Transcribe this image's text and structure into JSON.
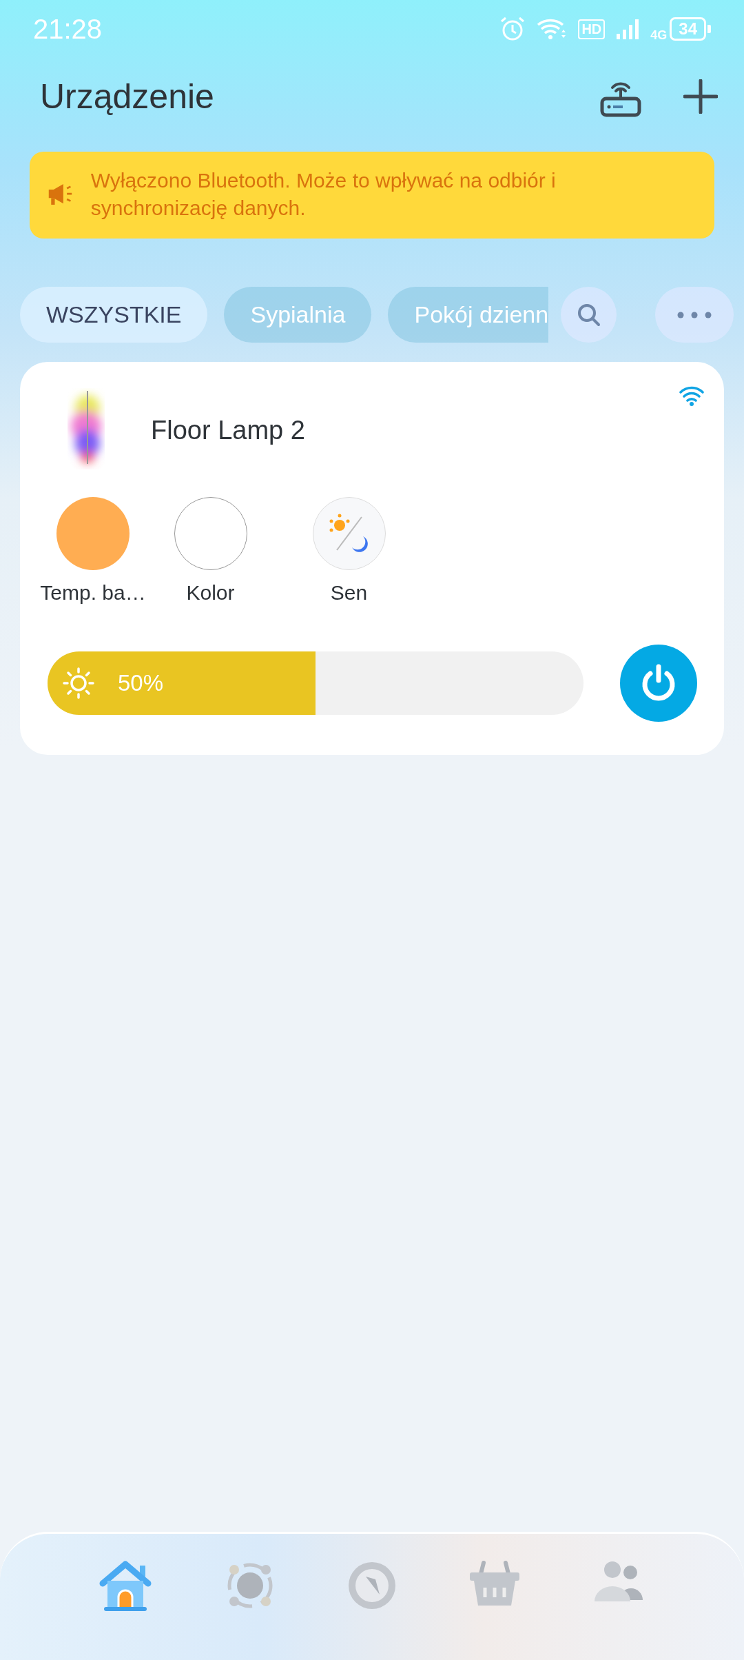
{
  "status_bar": {
    "time": "21:28",
    "hd": "HD",
    "network": "4G",
    "battery": "34"
  },
  "header": {
    "title": "Urządzenie"
  },
  "banner": {
    "text": "Wyłączono Bluetooth. Może to wpływać na odbiór i synchronizację danych."
  },
  "filters": [
    {
      "label": "WSZYSTKIE",
      "selected": true
    },
    {
      "label": "Sypialnia",
      "selected": false
    },
    {
      "label": "Pokój dzienn",
      "selected": false
    }
  ],
  "device": {
    "name": "Floor Lamp 2",
    "on": true,
    "modes": [
      {
        "kind": "temperature",
        "label": "Temp. ba…"
      },
      {
        "kind": "color",
        "label": "Kolor"
      },
      {
        "kind": "sleep",
        "label": "Sen"
      }
    ],
    "brightness": {
      "level": 0.5,
      "reading": "50%"
    }
  },
  "nav": [
    {
      "kind": "home",
      "selected": true
    },
    {
      "kind": "scenes",
      "selected": false
    },
    {
      "kind": "explore",
      "selected": false
    },
    {
      "kind": "shop",
      "selected": false
    },
    {
      "kind": "family",
      "selected": false
    }
  ]
}
